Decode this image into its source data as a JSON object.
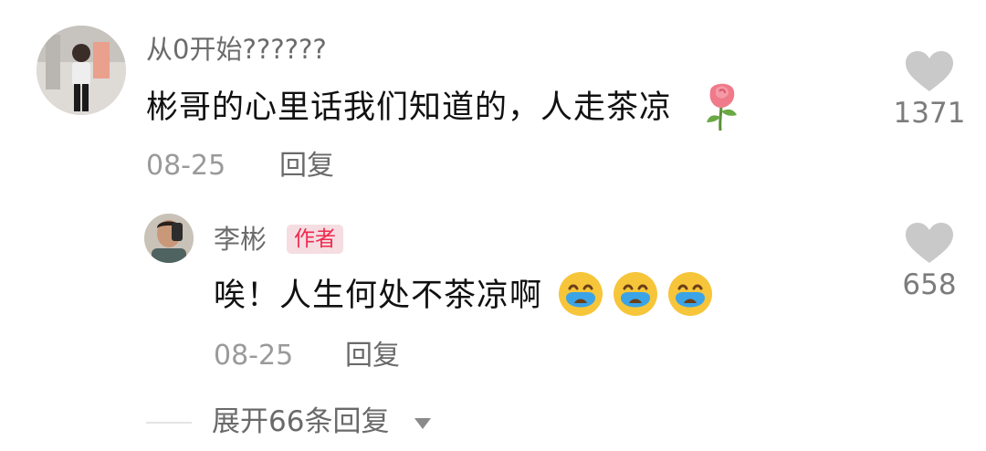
{
  "comment": {
    "username": "从0开始??????",
    "text": "彬哥的心里话我们知道的，人走茶凉",
    "emoji": "rose-icon",
    "date": "08-25",
    "reply_label": "回复",
    "like_count": "1371"
  },
  "reply": {
    "username": "李彬",
    "badge": "作者",
    "text": "唉！人生何处不茶凉啊",
    "emoji": [
      "crying-face-icon",
      "crying-face-icon",
      "crying-face-icon"
    ],
    "date": "08-25",
    "reply_label": "回复",
    "like_count": "658"
  },
  "expand_replies": {
    "label": "展开66条回复"
  },
  "colors": {
    "badge_text": "#f0294e",
    "badge_bg": "#f5dde2",
    "heart": "#c9c9c9",
    "secondary_text": "#9a9a9a"
  }
}
